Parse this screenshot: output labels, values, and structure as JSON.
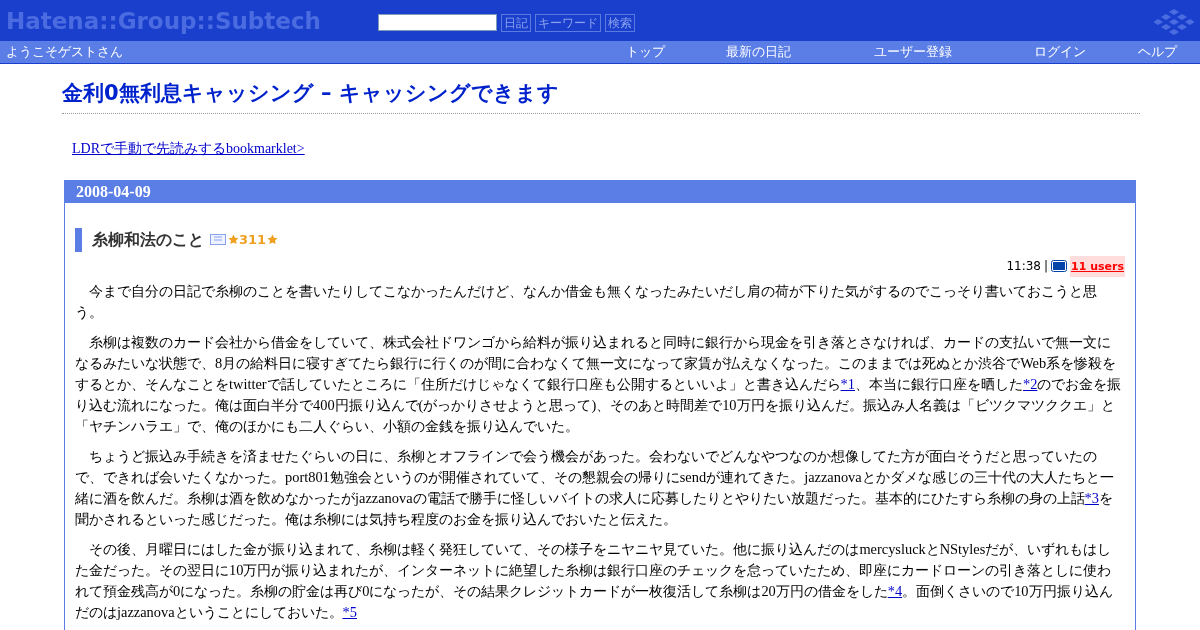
{
  "header": {
    "logo": "Hatena::Group::Subtech",
    "buttons": [
      "日記",
      "キーワード",
      "検索"
    ]
  },
  "navbar": {
    "welcome": "ようこそゲストさん",
    "links": [
      "トップ",
      "最新の日記",
      "ユーザー登録",
      "ログイン",
      "ヘルプ"
    ]
  },
  "title": "金利0無利息キャッシング – キャッシングできます",
  "top_link": "LDRで手動で先読みするbookmarklet>",
  "day": {
    "date": "2008-04-09",
    "section": {
      "heading": "糸柳和法のこと",
      "star_count": "311",
      "time": "11:38",
      "separator": "|",
      "bookmark_users": "11 users",
      "paragraphs": [
        [
          {
            "kind": "text",
            "text": "今まで自分の日記で糸柳のことを書いたりしてこなかったんだけど、なんか借金も無くなったみたいだし肩の荷が下りた気がするのでこっそり書いておこうと思う。"
          }
        ],
        [
          {
            "kind": "text",
            "text": "糸柳は複数のカード会社から借金をしていて、株式会社ドワンゴから給料が振り込まれると同時に銀行から現金を引き落とさなければ、カードの支払いで無一文になるみたいな状態で、8月の給料日に寝すぎてたら銀行に行くのが間に合わなくて無一文になって家賃が払えなくなった。このままでは死ぬとか渋谷でWeb系を惨殺をするとか、そんなことをtwitterで話していたところに「住所だけじゃなくて銀行口座も公開するといいよ」と書き込んだら"
          },
          {
            "kind": "link",
            "text": "*1"
          },
          {
            "kind": "text",
            "text": "、本当に銀行口座を晒した"
          },
          {
            "kind": "link",
            "text": "*2"
          },
          {
            "kind": "text",
            "text": "のでお金を振り込む流れになった。俺は面白半分で400円振り込んで(がっかりさせようと思って)、そのあと時間差で10万円を振り込んだ。振込み人名義は「ビツクマツククエ」と「ヤチンハラエ」で、俺のほかにも二人ぐらい、小額の金銭を振り込んでいた。"
          }
        ],
        [
          {
            "kind": "text",
            "text": "ちょうど振込み手続きを済ませたぐらいの日に、糸柳とオフラインで会う機会があった。会わないでどんなやつなのか想像してた方が面白そうだと思っていたので、できれば会いたくなかった。port801勉強会というのが開催されていて、その懇親会の帰りにsendが連れてきた。jazzanovaとかダメな感じの三十代の大人たちと一緒に酒を飲んだ。糸柳は酒を飲めなかったがjazzanovaの電話で勝手に怪しいバイトの求人に応募したりとやりたい放題だった。基本的にひたすら糸柳の身の上話"
          },
          {
            "kind": "link",
            "text": "*3"
          },
          {
            "kind": "text",
            "text": "を聞かされるといった感じだった。俺は糸柳には気持ち程度のお金を振り込んでおいたと伝えた。"
          }
        ],
        [
          {
            "kind": "text",
            "text": "その後、月曜日にはした金が振り込まれて、糸柳は軽く発狂していて、その様子をニヤニヤ見ていた。他に振り込んだのはmercysluckとNStylesだが、いずれもはした金だった。その翌日に10万円が振り込まれたが、インターネットに絶望した糸柳は銀行口座のチェックを怠っていたため、即座にカードローンの引き落としに使われて預金残高が0になった。糸柳の貯金は再び0になったが、その結果クレジットカードが一枚復活して糸柳は20万円の借金をした"
          },
          {
            "kind": "link",
            "text": "*4"
          },
          {
            "kind": "text",
            "text": "。面倒くさいので10万円振り込んだのはjazzanovaということにしておいた。"
          },
          {
            "kind": "link",
            "text": "*5"
          }
        ]
      ]
    }
  }
}
